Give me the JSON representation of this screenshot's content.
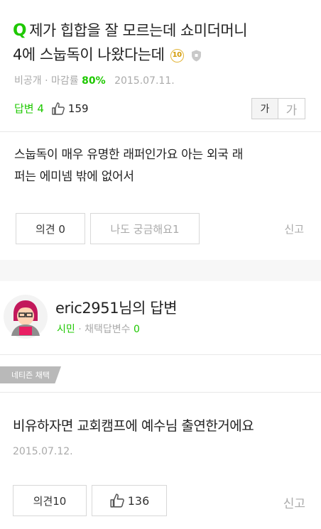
{
  "question": {
    "q_mark": "Q",
    "title_line1": "제가 힙합을 잘 모르는데 쇼미더머니",
    "title_line2": "4에 스눕독이 나왔다는데",
    "points_badge": "10",
    "visibility": "비공개",
    "close_rate_label": "마감률",
    "close_rate_value": "80%",
    "date": "2015.07.11.",
    "answers_label": "답변 4",
    "likes": "159",
    "font_small": "가",
    "font_large": "가",
    "body_line1": "스눕독이 매우 유명한 래퍼인가요 아는 외국 래",
    "body_line2": "퍼는 에미넴 밖에 없어서",
    "opinion_button": "의견 0",
    "curious_button": "나도 궁금해요1",
    "report": "신고"
  },
  "answer": {
    "author": "eric2951님의 답변",
    "rank": "시민",
    "adopted_label": "채택답변수",
    "adopted_count": "0",
    "chosen_tag": "네티즌 채택",
    "body": "비유하자면 교회캠프에 예수님 출연한거에요",
    "date": "2015.07.12.",
    "opinion_button": "의견10",
    "likes": "136",
    "report": "신고"
  },
  "colors": {
    "accent_green": "#1ec800",
    "muted_text": "#aaaaaa",
    "badge_gold": "#e2b437",
    "tag_grey": "#b9b9b9"
  },
  "icons": [
    "shield-icon",
    "thumbs-up-icon",
    "avatar-icon"
  ]
}
